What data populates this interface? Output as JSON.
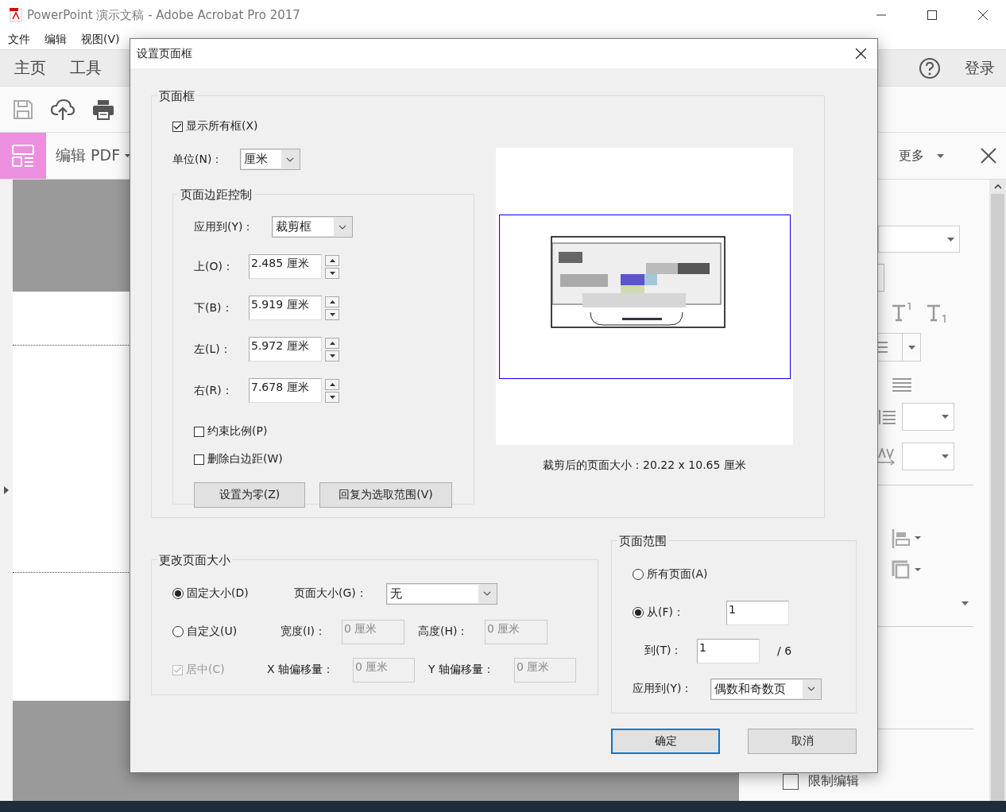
{
  "window": {
    "title": "PowerPoint 演示文稿 - Adobe Acrobat Pro 2017"
  },
  "menu": [
    "文件",
    "编辑",
    "视图(V)"
  ],
  "nav_tabs": [
    "主页",
    "工具"
  ],
  "login": "登录",
  "tool_header": {
    "title": "编辑 PDF",
    "more": "更多"
  },
  "right_panel": {
    "restrict_edit": {
      "label": "限制编辑",
      "checked": false
    }
  },
  "dialog": {
    "title": "设置页面框",
    "page_boxes": {
      "legend": "页面框",
      "show_all": {
        "label": "显示所有框(X)",
        "checked": true
      },
      "unit": {
        "label": "单位(N)：",
        "value": "厘米"
      },
      "margins": {
        "legend": "页面边距控制",
        "apply_to": {
          "label": "应用到(Y)：",
          "value": "裁剪框"
        },
        "fields": [
          {
            "label": "上(O)：",
            "value": "2.485 厘米"
          },
          {
            "label": "下(B)：",
            "value": "5.919 厘米"
          },
          {
            "label": "左(L)：",
            "value": "5.972 厘米"
          },
          {
            "label": "右(R)：",
            "value": "7.678 厘米"
          }
        ],
        "options": [
          {
            "label": "约束比例(P)",
            "checked": false
          },
          {
            "label": "删除白边距(W)",
            "checked": false
          }
        ],
        "buttons": [
          "设置为零(Z)",
          "回复为选取范围(V)"
        ]
      },
      "cropped_size": "裁剪后的页面大小：20.22 x 10.65 厘米"
    },
    "change_size": {
      "legend": "更改页面大小",
      "fixed": {
        "label": "固定大小(D)",
        "selected": true
      },
      "page_size": {
        "label": "页面大小(G)：",
        "value": "无"
      },
      "custom": {
        "label": "自定义(U)",
        "selected": false
      },
      "width": {
        "label": "宽度(I)：",
        "value": "0 厘米",
        "disabled": true
      },
      "height": {
        "label": "高度(H)：",
        "value": "0 厘米",
        "disabled": true
      },
      "center": {
        "label": "居中(C)",
        "checked": true,
        "disabled": true
      },
      "x_offset": {
        "label": "X 轴偏移量：",
        "value": "0 厘米",
        "disabled": true
      },
      "y_offset": {
        "label": "Y 轴偏移量：",
        "value": "0 厘米",
        "disabled": true
      }
    },
    "page_range": {
      "legend": "页面范围",
      "all": {
        "label": "所有页面(A)",
        "selected": false
      },
      "from": {
        "label": "从(F)：",
        "selected": true,
        "value": "1"
      },
      "to": {
        "label": "到(T)：",
        "value": "1",
        "total": "/ 6"
      },
      "apply_to": {
        "label": "应用到(Y)：",
        "value": "偶数和奇数页"
      }
    },
    "buttons": [
      {
        "label": "确定",
        "default": true
      },
      {
        "label": "取消",
        "default": false
      }
    ]
  }
}
